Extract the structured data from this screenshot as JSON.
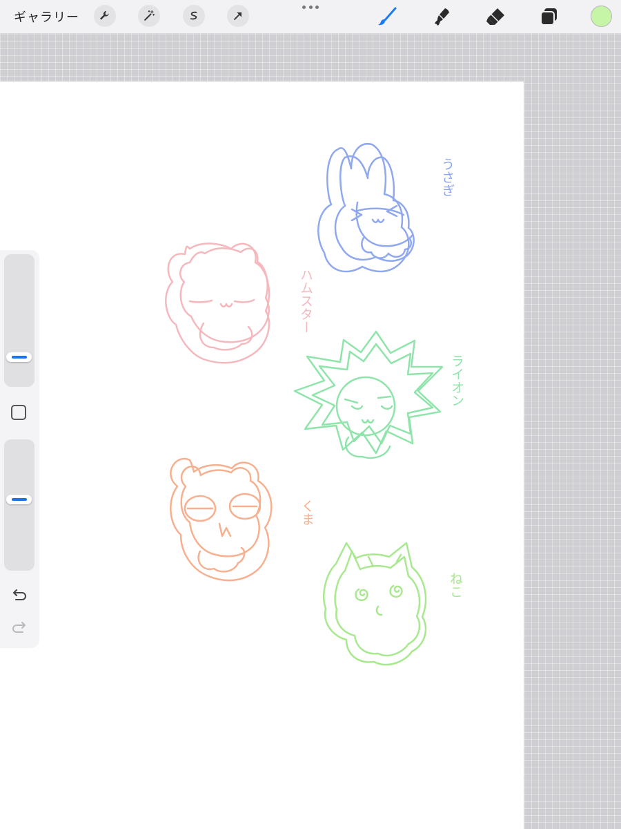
{
  "topbar": {
    "gallery_label": "ギャラリー",
    "left_tools": [
      "wrench-icon",
      "magic-wand-icon",
      "selection-icon",
      "transform-arrow-icon"
    ],
    "right_tools": [
      "brush-icon",
      "smudge-icon",
      "eraser-icon",
      "layers-icon"
    ],
    "active_tool": "brush-icon",
    "current_color": "#c6f5a8"
  },
  "canvas": {
    "labels": {
      "rabbit": "うさぎ",
      "hamster": "ハムスター",
      "lion": "ライオン",
      "bear": "くま",
      "cat": "ねこ"
    },
    "colors": {
      "rabbit": "#8fa8ee",
      "hamster": "#f4b8bd",
      "lion": "#8fe4aa",
      "bear": "#f7b08f",
      "cat": "#a8e88f"
    }
  },
  "sidebar": {
    "brush_size_level": 0.18,
    "opacity_level": 0.55,
    "undo_icon": "undo-icon",
    "redo_icon": "redo-icon"
  }
}
